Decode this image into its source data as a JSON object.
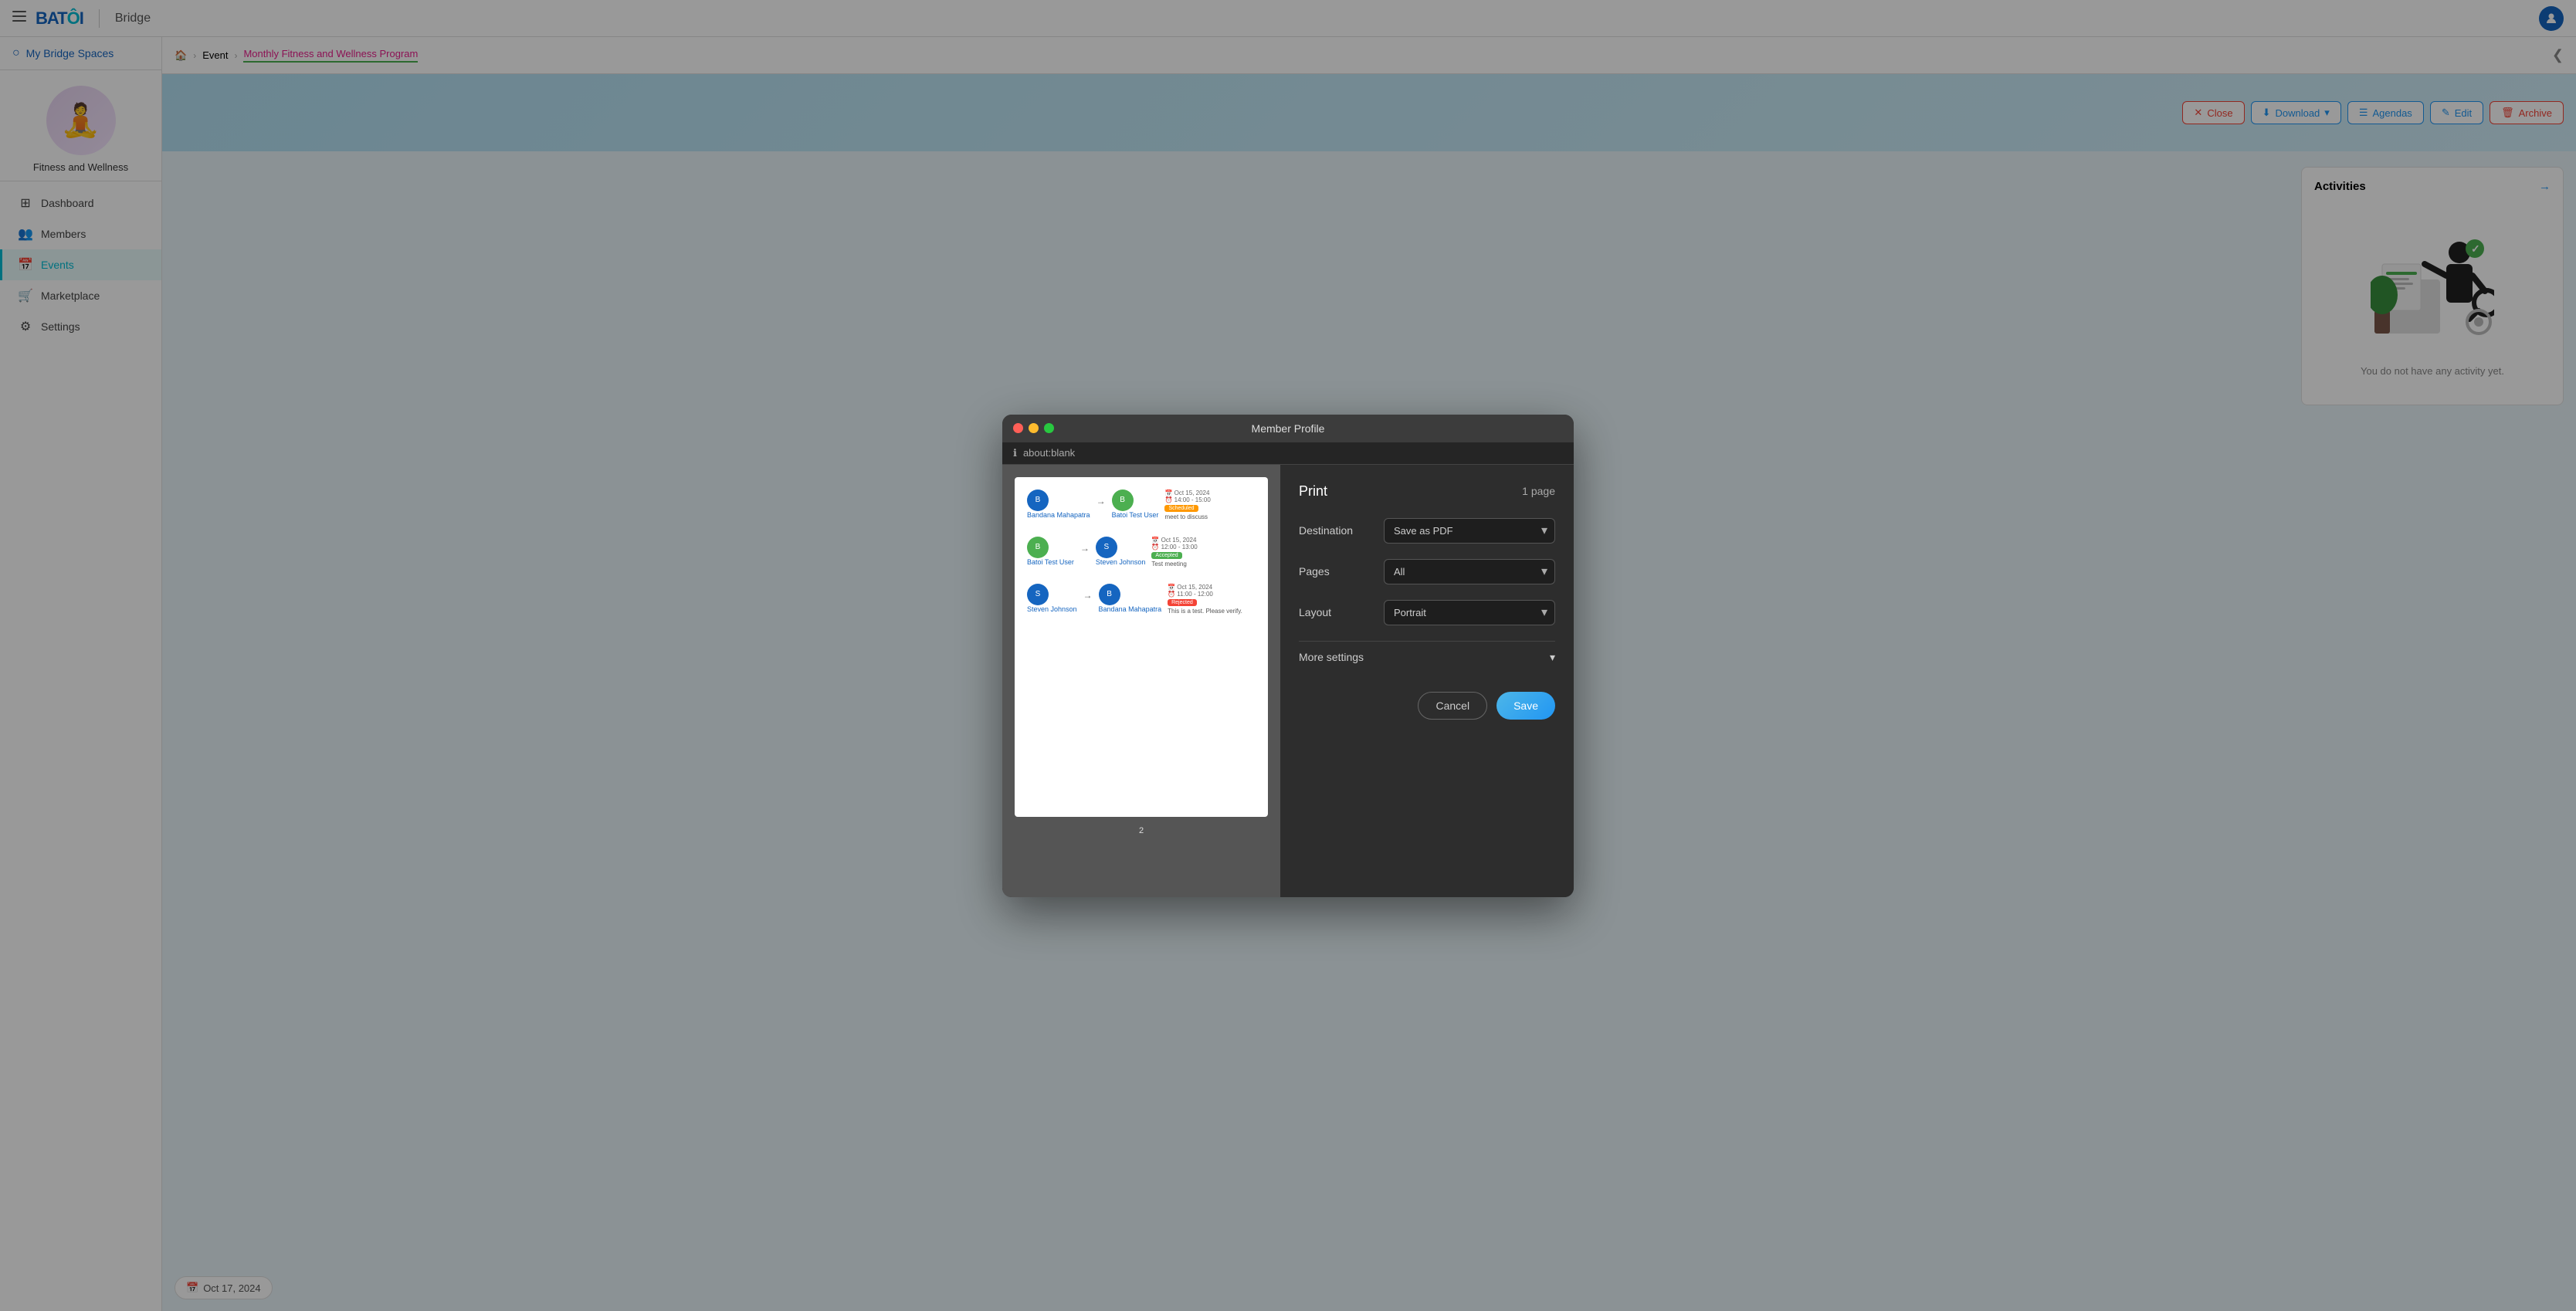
{
  "topbar": {
    "logo": "BATOI",
    "app_name": "Bridge",
    "avatar_initial": "👤"
  },
  "sidebar": {
    "my_spaces_label": "My Bridge Spaces",
    "space_emoji": "🧘",
    "space_name": "Fitness and Wellness",
    "nav_items": [
      {
        "id": "dashboard",
        "label": "Dashboard",
        "icon": "⊞"
      },
      {
        "id": "members",
        "label": "Members",
        "icon": "👥"
      },
      {
        "id": "events",
        "label": "Events",
        "icon": "📅",
        "active": true
      },
      {
        "id": "marketplace",
        "label": "Marketplace",
        "icon": "🛒"
      },
      {
        "id": "settings",
        "label": "Settings",
        "icon": "⚙"
      }
    ]
  },
  "breadcrumb": {
    "home_icon": "🏠",
    "event_label": "Event",
    "current_label": "Monthly Fitness and Wellness Program"
  },
  "toolbar": {
    "close_label": "Close",
    "download_label": "Download",
    "agendas_label": "Agendas",
    "edit_label": "Edit",
    "archive_label": "Archive"
  },
  "activities": {
    "title": "Activities",
    "empty_message": "You do not have any activity yet."
  },
  "print_dialog": {
    "title": "Member Profile",
    "url": "about:blank",
    "print_label": "Print",
    "pages_count": "1 page",
    "destination_label": "Destination",
    "destination_value": "Save as PDF",
    "pages_label": "Pages",
    "pages_value": "All",
    "layout_label": "Layout",
    "layout_value": "Portrait",
    "more_settings_label": "More settings",
    "cancel_label": "Cancel",
    "save_label": "Save",
    "preview": {
      "rows": [
        {
          "from_name": "Bandana Mahapatra",
          "to_name": "Batoi Test User",
          "date": "Oct 15, 2024",
          "time": "14:00 - 15:00",
          "badge": "Scheduled",
          "badge_color": "orange",
          "message": "meet to discuss"
        },
        {
          "from_name": "Batoi Test User",
          "to_name": "Steven Johnson",
          "date": "Oct 15, 2024",
          "time": "12:00 - 13:00",
          "badge": "Accepted",
          "badge_color": "green",
          "message": "Test meeting"
        },
        {
          "from_name": "Steven Johnson",
          "to_name": "Bandana Mahapatra",
          "date": "Oct 15, 2024",
          "time": "11:00 - 12:00",
          "badge": "Rejected",
          "badge_color": "red",
          "message": "This is a test. Please verify."
        }
      ]
    }
  },
  "bottom": {
    "date_icon": "📅",
    "date_label": "Oct 17, 2024"
  }
}
